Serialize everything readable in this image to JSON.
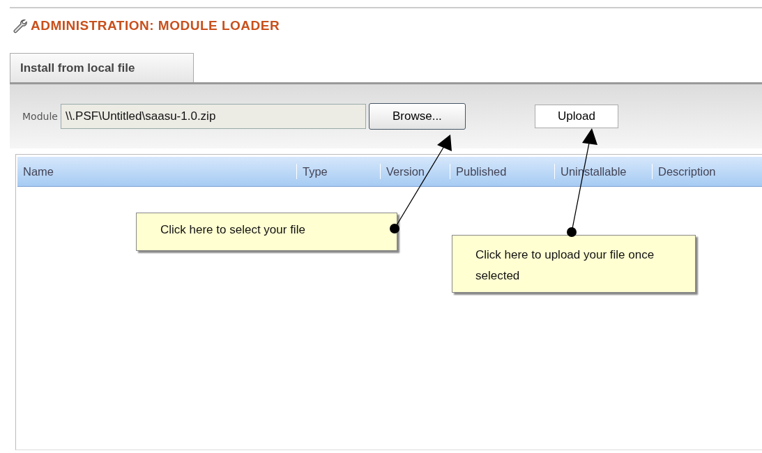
{
  "page_title": "ADMINISTRATION: MODULE LOADER",
  "tabs": [
    {
      "label": "Install from local file",
      "selected": true
    }
  ],
  "module_field": {
    "label": "Module",
    "value": "\\\\.PSF\\Untitled\\saasu-1.0.zip"
  },
  "browse_button": "Browse...",
  "upload_button": "Upload",
  "table": {
    "columns": [
      "Name",
      "Type",
      "Version",
      "Published",
      "Uninstallable",
      "Description"
    ]
  },
  "callouts": [
    {
      "text": "Click here to select your file"
    },
    {
      "text": "Click here to upload your file once selected"
    }
  ]
}
